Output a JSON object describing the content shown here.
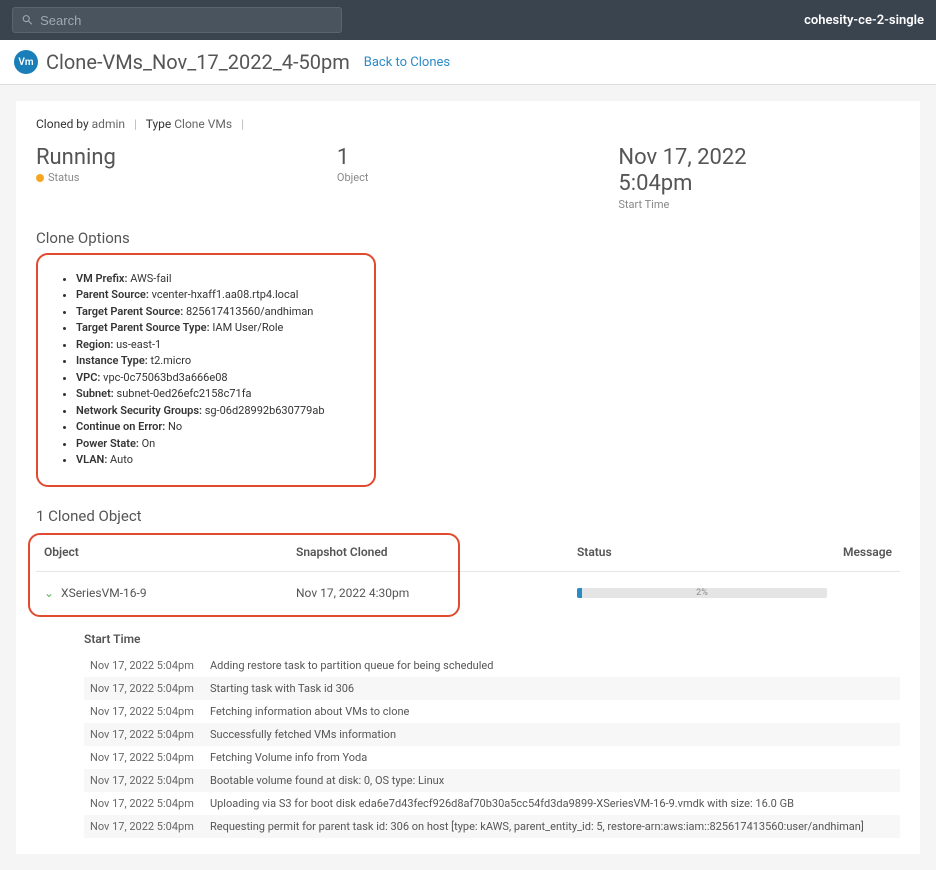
{
  "topbar": {
    "search_placeholder": "Search",
    "cluster": "cohesity-ce-2-single"
  },
  "header": {
    "badge": "Vm",
    "title": "Clone-VMs_Nov_17_2022_4-50pm",
    "back_link": "Back to Clones"
  },
  "meta": {
    "cloned_by_label": "Cloned by",
    "cloned_by_value": "admin",
    "type_label": "Type",
    "type_value": "Clone VMs"
  },
  "summary": {
    "status_value": "Running",
    "status_label": "Status",
    "object_value": "1",
    "object_label": "Object",
    "start_value": "Nov 17, 2022 5:04pm",
    "start_label": "Start Time"
  },
  "clone_options": {
    "heading": "Clone Options",
    "items": [
      {
        "k": "VM Prefix:",
        "v": " AWS-fail"
      },
      {
        "k": "Parent Source:",
        "v": " vcenter-hxaff1.aa08.rtp4.local"
      },
      {
        "k": "Target Parent Source:",
        "v": " 825617413560/andhiman"
      },
      {
        "k": "Target Parent Source Type:",
        "v": " IAM User/Role"
      },
      {
        "k": "Region:",
        "v": " us-east-1"
      },
      {
        "k": "Instance Type:",
        "v": " t2.micro"
      },
      {
        "k": "VPC:",
        "v": " vpc-0c75063bd3a666e08"
      },
      {
        "k": "Subnet:",
        "v": " subnet-0ed26efc2158c71fa"
      },
      {
        "k": "Network Security Groups:",
        "v": "  sg-06d28992b630779ab"
      },
      {
        "k": "Continue on Error:",
        "v": " No"
      },
      {
        "k": "Power State:",
        "v": " On"
      },
      {
        "k": "VLAN:",
        "v": " Auto"
      }
    ]
  },
  "cloned_object": {
    "heading": "1 Cloned Object",
    "columns": {
      "object": "Object",
      "snapshot": "Snapshot Cloned",
      "status": "Status",
      "message": "Message"
    },
    "row": {
      "object": "XSeriesVM-16-9",
      "snapshot": "Nov 17, 2022 4:30pm",
      "progress_pct": "2%"
    }
  },
  "log": {
    "heading": "Start Time",
    "rows": [
      {
        "t": "Nov 17, 2022 5:04pm",
        "m": "Adding restore task to partition queue for being scheduled"
      },
      {
        "t": "Nov 17, 2022 5:04pm",
        "m": "Starting task with Task id 306"
      },
      {
        "t": "Nov 17, 2022 5:04pm",
        "m": "Fetching information about VMs to clone"
      },
      {
        "t": "Nov 17, 2022 5:04pm",
        "m": "Successfully fetched VMs information"
      },
      {
        "t": "Nov 17, 2022 5:04pm",
        "m": "Fetching Volume info from Yoda"
      },
      {
        "t": "Nov 17, 2022 5:04pm",
        "m": "Bootable volume found at disk: 0, OS type: Linux"
      },
      {
        "t": "Nov 17, 2022 5:04pm",
        "m": "Uploading via S3 for boot disk eda6e7d43fecf926d8af70b30a5cc54fd3da9899-XSeriesVM-16-9.vmdk with size: 16.0 GB"
      },
      {
        "t": "Nov 17, 2022 5:04pm",
        "m": "Requesting permit for parent task id: 306 on host [type: kAWS, parent_entity_id: 5, restore-arn:aws:iam::825617413560:user/andhiman]"
      }
    ]
  }
}
